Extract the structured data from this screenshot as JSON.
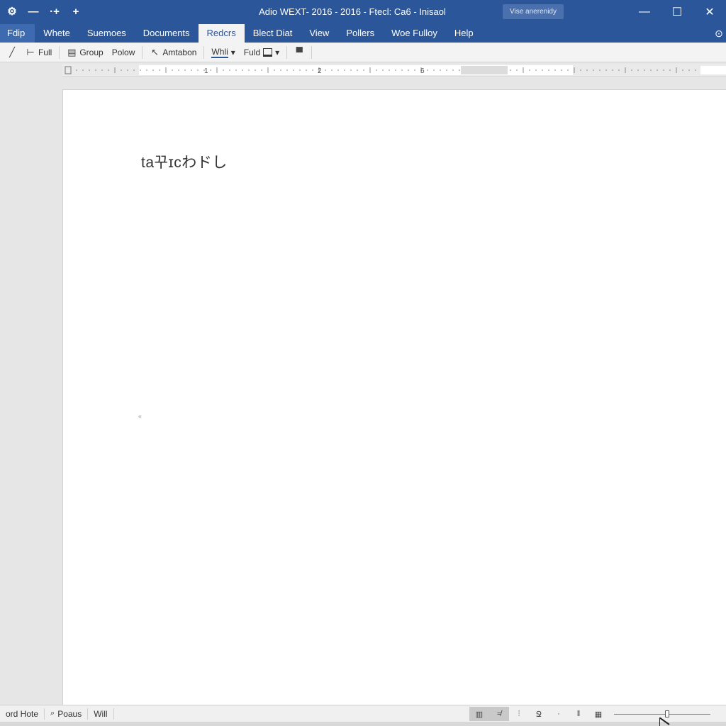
{
  "titlebar": {
    "quick_access": [
      "⚙",
      "—",
      "·+",
      "+"
    ],
    "title": "Adio WEXT- 2016 - 2016 - Ftecl: Ca6 - Inisaol",
    "signin_label": "Vise anerenidy",
    "controls": [
      "—",
      "☐",
      "✕"
    ]
  },
  "menu": {
    "tabs": [
      "Fdip",
      "Whete",
      "Suemoes",
      "Documents",
      "Redcrs",
      "Blect Diat",
      "View",
      "Pollers",
      "Woe Fulloy",
      "Help"
    ],
    "active_index": 4,
    "extra_icon": "⊙"
  },
  "toolbar": {
    "items": [
      {
        "icon": "╱",
        "label": ""
      },
      {
        "icon": "⊢",
        "label": "Full"
      },
      {
        "icon": "▤",
        "label": "Group"
      },
      {
        "icon": "",
        "label": "Polow"
      },
      {
        "icon": "↖",
        "label": "Amtabon"
      },
      {
        "icon": "",
        "label": "Whli",
        "dropdown": "▾"
      },
      {
        "icon": "",
        "label": "Fuld",
        "dropdown": "▾"
      },
      {
        "icon": "▀",
        "label": ""
      }
    ]
  },
  "ruler": {
    "labels": [
      "1",
      "2",
      "6"
    ]
  },
  "document": {
    "text": "ta꾸ɪcわドし",
    "mark": "«"
  },
  "statusbar": {
    "left": [
      "ord Hote",
      "Poaus",
      "Will"
    ],
    "search_icon": "🔍",
    "view_icons": [
      "▥",
      "≉",
      "⫶",
      "Ջ",
      "·",
      "‖",
      "▦"
    ],
    "zoom_fraction": 0.55
  },
  "colors": {
    "ribbon_blue": "#2b579a",
    "page": "#ffffff",
    "chrome": "#f3f3f3"
  }
}
